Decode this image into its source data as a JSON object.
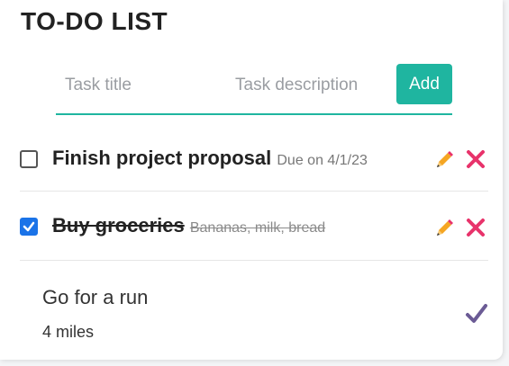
{
  "header": {
    "title": "TO-DO LIST"
  },
  "form": {
    "title_placeholder": "Task title",
    "description_placeholder": "Task description",
    "add_label": "Add"
  },
  "tasks": [
    {
      "title": "Finish project proposal",
      "description": "Due on 4/1/23",
      "completed": false
    },
    {
      "title": "Buy groceries",
      "description": "Bananas, milk, bread",
      "completed": true
    }
  ],
  "editing": {
    "title": "Go for a run",
    "description": "4 miles"
  },
  "colors": {
    "accent": "#1fb5a0",
    "edit_icon": "#f5a623",
    "delete_icon": "#e8336b",
    "save_icon": "#6b5b95",
    "checkbox": "#1a73e8"
  },
  "icons": {
    "edit": "pencil-icon",
    "delete": "close-icon",
    "save": "checkmark-icon"
  }
}
